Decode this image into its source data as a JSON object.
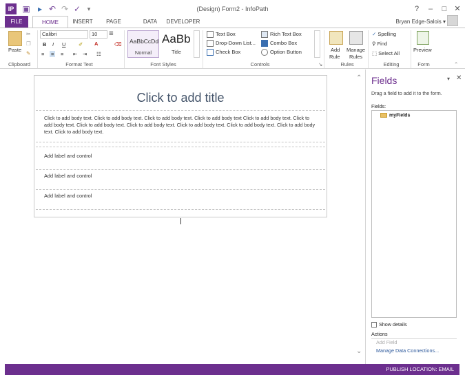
{
  "window": {
    "title": "(Design) Form2 - InfoPath",
    "help": "?",
    "minimize": "–",
    "maximize": "□",
    "close": "✕"
  },
  "tabs": [
    "FILE",
    "HOME",
    "INSERT",
    "PAGE DESIGN",
    "DATA",
    "DEVELOPER"
  ],
  "user": {
    "name": "Bryan Edge-Salois",
    "caret": "▾"
  },
  "ribbon": {
    "clipboard": {
      "paste": "Paste",
      "label": "Clipboard"
    },
    "format_text": {
      "font": "Calibri",
      "size": "10",
      "bold": "B",
      "italic": "I",
      "underline": "U",
      "label": "Format Text"
    },
    "font_styles": {
      "normal_sample": "AaBbCcDd",
      "normal": "Normal",
      "title_sample": "AaBb",
      "title": "Title",
      "label": "Font Styles"
    },
    "controls": {
      "items": [
        "Text Box",
        "Rich Text Box",
        "Drop-Down List...",
        "Combo Box",
        "Check Box",
        "Option Button"
      ],
      "label": "Controls"
    },
    "rules": {
      "add_rule_1": "Add",
      "add_rule_2": "Rule",
      "manage_1": "Manage",
      "manage_2": "Rules",
      "label": "Rules"
    },
    "editing": {
      "spelling": "Spelling",
      "find": "Find",
      "select_all": "Select All",
      "label": "Editing"
    },
    "form": {
      "preview": "Preview",
      "label": "Form"
    }
  },
  "document": {
    "title": "Click to add title",
    "body": "Click to add body text. Click to add body text. Click to add body text. Click to add body text Click to add body text. Click to add body text. Click to add body text. Click to add body text. Click to add body text. Click to add body text. Click to add body text. Click to add body text.",
    "labels": [
      "Add label and control",
      "Add label and control",
      "Add label and control"
    ]
  },
  "fields_pane": {
    "title": "Fields",
    "description": "Drag a field to add it to the form.",
    "fields_label": "Fields:",
    "root_field": "myFields",
    "show_details": "Show details",
    "actions_label": "Actions",
    "add_field": "Add Field",
    "manage_data": "Manage Data Connections..."
  },
  "status": {
    "text": "PUBLISH LOCATION: EMAIL"
  },
  "colors": {
    "accent": "#6c2f8e",
    "link": "#2b579a"
  }
}
